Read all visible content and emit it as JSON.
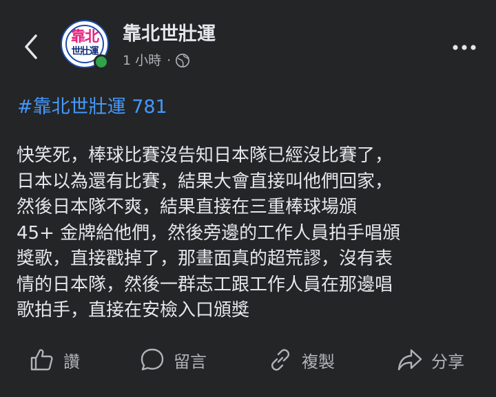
{
  "header": {
    "page_name": "靠北世壯運",
    "time": "1 小時",
    "separator": "·",
    "avatar_line1": "靠北",
    "avatar_line2": "世壯運"
  },
  "post": {
    "hashtag": "#靠北世壯運 781",
    "lines": [
      "快笑死，棒球比賽沒告知日本隊已經沒比賽了，",
      "日本以為還有比賽，結果大會直接叫他們回家，",
      "然後日本隊不爽，結果直接在三重棒球場頒",
      " 45+ 金牌給他們，然後旁邊的工作人員拍手唱頒",
      "獎歌，直接戳掉了，那畫面真的超荒謬，沒有表",
      "情的日本隊，然後一群志工跟工作人員在那邊唱",
      "歌拍手，直接在安檢入口頒獎"
    ]
  },
  "actions": {
    "like": "讚",
    "comment": "留言",
    "copy": "複製",
    "share": "分享"
  },
  "colors": {
    "background": "#242526",
    "text": "#e4e6eb",
    "secondary": "#b0b3b8",
    "link": "#4599ff",
    "online": "#31a24c"
  },
  "icons": [
    "back-icon",
    "globe-icon",
    "more-icon",
    "like-icon",
    "comment-icon",
    "copy-icon",
    "share-icon"
  ]
}
